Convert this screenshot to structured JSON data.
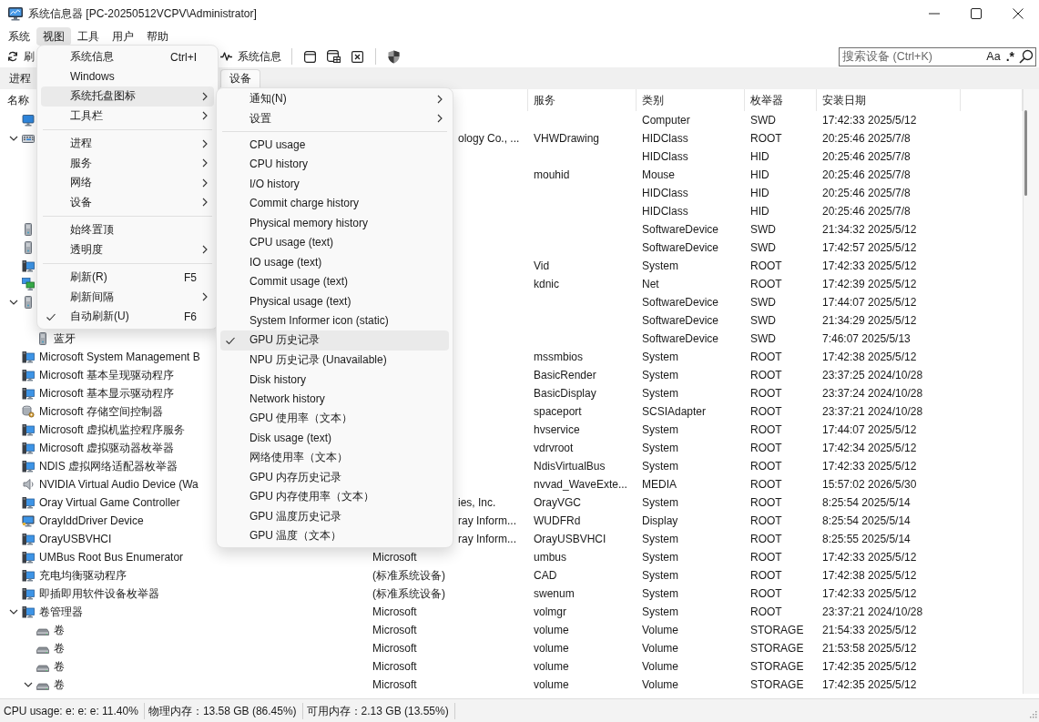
{
  "title": "系统信息器 [PC-20250512VCPV\\Administrator]",
  "menubar": [
    {
      "label": "系统",
      "selected": false
    },
    {
      "label": "视图",
      "selected": true
    },
    {
      "label": "工具",
      "selected": false
    },
    {
      "label": "用户",
      "selected": false
    },
    {
      "label": "帮助",
      "selected": false
    }
  ],
  "toolbar": {
    "buttons": [
      {
        "label": "刷"
      },
      {
        "label": "系统信息"
      }
    ]
  },
  "search": {
    "placeholder": "搜索设备 (Ctrl+K)",
    "toggles": [
      "Aa",
      ".*"
    ]
  },
  "tabs": [
    {
      "label": "进程",
      "selected": false
    },
    {
      "label": "设备",
      "selected": true
    }
  ],
  "table": {
    "columns": [
      {
        "label": "名称"
      },
      {
        "label": "服务"
      },
      {
        "label": "类别"
      },
      {
        "label": "枚举器"
      },
      {
        "label": "安装日期"
      }
    ],
    "rows": [
      {
        "kind": "computer",
        "class": "Computer",
        "enumerator": "SWD",
        "install_date": "17:42:33 2025/5/12"
      },
      {
        "kind": "hid",
        "expanded": true,
        "column_2": "ology Co., ...",
        "service": "VHWDrawing",
        "class": "HIDClass",
        "enumerator": "ROOT",
        "install_date": "20:25:46 2025/7/8",
        "children": [
          {
            "class": "HIDClass",
            "enumerator": "HID",
            "install_date": "20:25:46 2025/7/8"
          },
          {
            "service": "mouhid",
            "class": "Mouse",
            "enumerator": "HID",
            "install_date": "20:25:46 2025/7/8"
          },
          {
            "class": "HIDClass",
            "enumerator": "HID",
            "install_date": "20:25:46 2025/7/8"
          },
          {
            "class": "HIDClass",
            "enumerator": "HID",
            "install_date": "20:25:46 2025/7/8"
          }
        ]
      },
      {
        "kind": "tower",
        "class": "SoftwareDevice",
        "enumerator": "SWD",
        "install_date": "21:34:32 2025/5/12"
      },
      {
        "kind": "tower",
        "class": "SoftwareDevice",
        "enumerator": "SWD",
        "install_date": "17:42:57 2025/5/12"
      },
      {
        "kind": "system",
        "service": "Vid",
        "class": "System",
        "enumerator": "ROOT",
        "install_date": "17:42:33 2025/5/12"
      },
      {
        "kind": "network",
        "service": "kdnic",
        "class": "Net",
        "enumerator": "ROOT",
        "install_date": "17:42:39 2025/5/12"
      },
      {
        "kind": "tower",
        "expanded": true,
        "class": "SoftwareDevice",
        "enumerator": "SWD",
        "install_date": "17:44:07 2025/5/12",
        "children": [
          {
            "class": "SoftwareDevice",
            "enumerator": "SWD",
            "install_date": "21:34:29 2025/5/12"
          },
          {
            "kind": "tower",
            "name": "蓝牙",
            "class": "SoftwareDevice",
            "enumerator": "SWD",
            "install_date": "7:46:07 2025/5/13"
          }
        ]
      },
      {
        "kind": "system",
        "name": "Microsoft System Management B",
        "service": "mssmbios",
        "class": "System",
        "enumerator": "ROOT",
        "install_date": "17:42:38 2025/5/12"
      },
      {
        "kind": "system",
        "name": "Microsoft 基本呈现驱动程序",
        "service": "BasicRender",
        "class": "System",
        "enumerator": "ROOT",
        "install_date": "23:37:25 2024/10/28"
      },
      {
        "kind": "system",
        "name": "Microsoft 基本显示驱动程序",
        "service": "BasicDisplay",
        "class": "System",
        "enumerator": "ROOT",
        "install_date": "23:37:24 2024/10/28"
      },
      {
        "kind": "storage",
        "name": "Microsoft 存储空间控制器",
        "service": "spaceport",
        "class": "SCSIAdapter",
        "enumerator": "ROOT",
        "install_date": "23:37:21 2024/10/28"
      },
      {
        "kind": "system",
        "name": "Microsoft 虚拟机监控程序服务",
        "service": "hvservice",
        "class": "System",
        "enumerator": "ROOT",
        "install_date": "17:44:07 2025/5/12"
      },
      {
        "kind": "system",
        "name": "Microsoft 虚拟驱动器枚举器",
        "service": "vdrvroot",
        "class": "System",
        "enumerator": "ROOT",
        "install_date": "17:42:34 2025/5/12"
      },
      {
        "kind": "system",
        "name": "NDIS 虚拟网络适配器枚举器",
        "service": "NdisVirtualBus",
        "class": "System",
        "enumerator": "ROOT",
        "install_date": "17:42:33 2025/5/12"
      },
      {
        "kind": "audio",
        "name": "NVIDIA Virtual Audio Device (Wa",
        "service": "nvvad_WaveExte...",
        "class": "MEDIA",
        "enumerator": "ROOT",
        "install_date": "15:57:02 2026/5/30"
      },
      {
        "kind": "system",
        "name": "Oray Virtual Game Controller",
        "column_2": "ies, Inc.",
        "service": "OrayVGC",
        "class": "System",
        "enumerator": "ROOT",
        "install_date": "8:25:54 2025/5/14"
      },
      {
        "kind": "display",
        "name": "OrayIddDriver Device",
        "column_2": "ray Inform...",
        "service": "WUDFRd",
        "class": "Display",
        "enumerator": "ROOT",
        "install_date": "8:25:54 2025/5/14"
      },
      {
        "kind": "system",
        "name": "OrayUSBVHCI",
        "column_2": "ray Inform...",
        "service": "OrayUSBVHCI",
        "class": "System",
        "enumerator": "ROOT",
        "install_date": "8:25:55 2025/5/14"
      },
      {
        "kind": "system",
        "name": "UMBus Root Bus Enumerator",
        "column_2": "Microsoft",
        "service": "umbus",
        "class": "System",
        "enumerator": "ROOT",
        "install_date": "17:42:33 2025/5/12"
      },
      {
        "kind": "system",
        "name": "充电均衡驱动程序",
        "column_2": "(标准系统设备)",
        "service": "CAD",
        "class": "System",
        "enumerator": "ROOT",
        "install_date": "17:42:38 2025/5/12"
      },
      {
        "kind": "system",
        "name": "即插即用软件设备枚举器",
        "column_2": "(标准系统设备)",
        "service": "swenum",
        "class": "System",
        "enumerator": "ROOT",
        "install_date": "17:42:33 2025/5/12"
      },
      {
        "kind": "system",
        "name": "卷管理器",
        "expanded": true,
        "column_2": "Microsoft",
        "service": "volmgr",
        "class": "System",
        "enumerator": "ROOT",
        "install_date": "23:37:21 2024/10/28",
        "children": [
          {
            "kind": "drive",
            "name": "卷",
            "column_2": "Microsoft",
            "service": "volume",
            "class": "Volume",
            "enumerator": "STORAGE",
            "install_date": "21:54:33 2025/5/12"
          },
          {
            "kind": "drive",
            "name": "卷",
            "column_2": "Microsoft",
            "service": "volume",
            "class": "Volume",
            "enumerator": "STORAGE",
            "install_date": "21:53:58 2025/5/12"
          },
          {
            "kind": "drive",
            "name": "卷",
            "column_2": "Microsoft",
            "service": "volume",
            "class": "Volume",
            "enumerator": "STORAGE",
            "install_date": "17:42:35 2025/5/12"
          },
          {
            "kind": "drive",
            "name": "卷",
            "expanded": true,
            "column_2": "Microsoft",
            "service": "volume",
            "class": "Volume",
            "enumerator": "STORAGE",
            "install_date": "17:42:35 2025/5/12"
          }
        ]
      }
    ]
  },
  "view_menu": {
    "items": [
      {
        "kind": "item",
        "label": "系统信息",
        "shortcut": "Ctrl+I",
        "checked": false,
        "highlighted": false
      },
      {
        "kind": "item",
        "label": "Windows",
        "checked": false,
        "highlighted": false
      },
      {
        "kind": "submenu",
        "label": "系统托盘图标",
        "checked": false,
        "highlighted": true
      },
      {
        "kind": "submenu",
        "label": "工具栏",
        "checked": false,
        "highlighted": false
      },
      {
        "kind": "separator"
      },
      {
        "kind": "submenu",
        "label": "进程",
        "checked": false,
        "highlighted": false
      },
      {
        "kind": "submenu",
        "label": "服务",
        "checked": false,
        "highlighted": false
      },
      {
        "kind": "submenu",
        "label": "网络",
        "checked": false,
        "highlighted": false
      },
      {
        "kind": "submenu",
        "label": "设备",
        "checked": false,
        "highlighted": false
      },
      {
        "kind": "separator"
      },
      {
        "kind": "item",
        "label": "始终置顶",
        "checked": false,
        "highlighted": false
      },
      {
        "kind": "submenu",
        "label": "透明度",
        "checked": false,
        "highlighted": false
      },
      {
        "kind": "separator"
      },
      {
        "kind": "item",
        "label": "刷新(R)",
        "shortcut": "F5",
        "checked": false,
        "highlighted": false
      },
      {
        "kind": "submenu",
        "label": "刷新间隔",
        "checked": false,
        "highlighted": false
      },
      {
        "kind": "item",
        "label": "自动刷新(U)",
        "shortcut": "F6",
        "checked": true,
        "highlighted": false
      }
    ]
  },
  "tray_submenu": {
    "items": [
      {
        "kind": "submenu",
        "label": "通知(N)",
        "checked": false,
        "highlighted": false
      },
      {
        "kind": "submenu",
        "label": "设置",
        "checked": false,
        "highlighted": false
      },
      {
        "kind": "separator"
      },
      {
        "kind": "item",
        "label": "CPU usage",
        "checked": false,
        "highlighted": false
      },
      {
        "kind": "item",
        "label": "CPU history",
        "checked": false,
        "highlighted": false
      },
      {
        "kind": "item",
        "label": "I/O history",
        "checked": false,
        "highlighted": false
      },
      {
        "kind": "item",
        "label": "Commit charge history",
        "checked": false,
        "highlighted": false
      },
      {
        "kind": "item",
        "label": "Physical memory history",
        "checked": false,
        "highlighted": false
      },
      {
        "kind": "item",
        "label": "CPU usage (text)",
        "checked": false,
        "highlighted": false
      },
      {
        "kind": "item",
        "label": "IO usage (text)",
        "checked": false,
        "highlighted": false
      },
      {
        "kind": "item",
        "label": "Commit usage (text)",
        "checked": false,
        "highlighted": false
      },
      {
        "kind": "item",
        "label": "Physical usage (text)",
        "checked": false,
        "highlighted": false
      },
      {
        "kind": "item",
        "label": "System Informer icon (static)",
        "checked": false,
        "highlighted": false
      },
      {
        "kind": "item",
        "label": "GPU 历史记录",
        "checked": true,
        "highlighted": true
      },
      {
        "kind": "item",
        "label": "NPU 历史记录 (Unavailable)",
        "checked": false,
        "highlighted": false
      },
      {
        "kind": "item",
        "label": "Disk history",
        "checked": false,
        "highlighted": false
      },
      {
        "kind": "item",
        "label": "Network history",
        "checked": false,
        "highlighted": false
      },
      {
        "kind": "item",
        "label": "GPU 使用率（文本）",
        "checked": false,
        "highlighted": false
      },
      {
        "kind": "item",
        "label": "Disk usage (text)",
        "checked": false,
        "highlighted": false
      },
      {
        "kind": "item",
        "label": "网络使用率（文本）",
        "checked": false,
        "highlighted": false
      },
      {
        "kind": "item",
        "label": "GPU 内存历史记录",
        "checked": false,
        "highlighted": false
      },
      {
        "kind": "item",
        "label": "GPU 内存使用率（文本）",
        "checked": false,
        "highlighted": false
      },
      {
        "kind": "item",
        "label": "GPU 温度历史记录",
        "checked": false,
        "highlighted": false
      },
      {
        "kind": "item",
        "label": "GPU 温度（文本）",
        "checked": false,
        "highlighted": false
      }
    ]
  },
  "status_bar": [
    "CPU usage: e: e: e: 11.40%",
    "物理内存：13.58 GB (86.45%)",
    "可用内存：2.13 GB (13.55%)"
  ]
}
